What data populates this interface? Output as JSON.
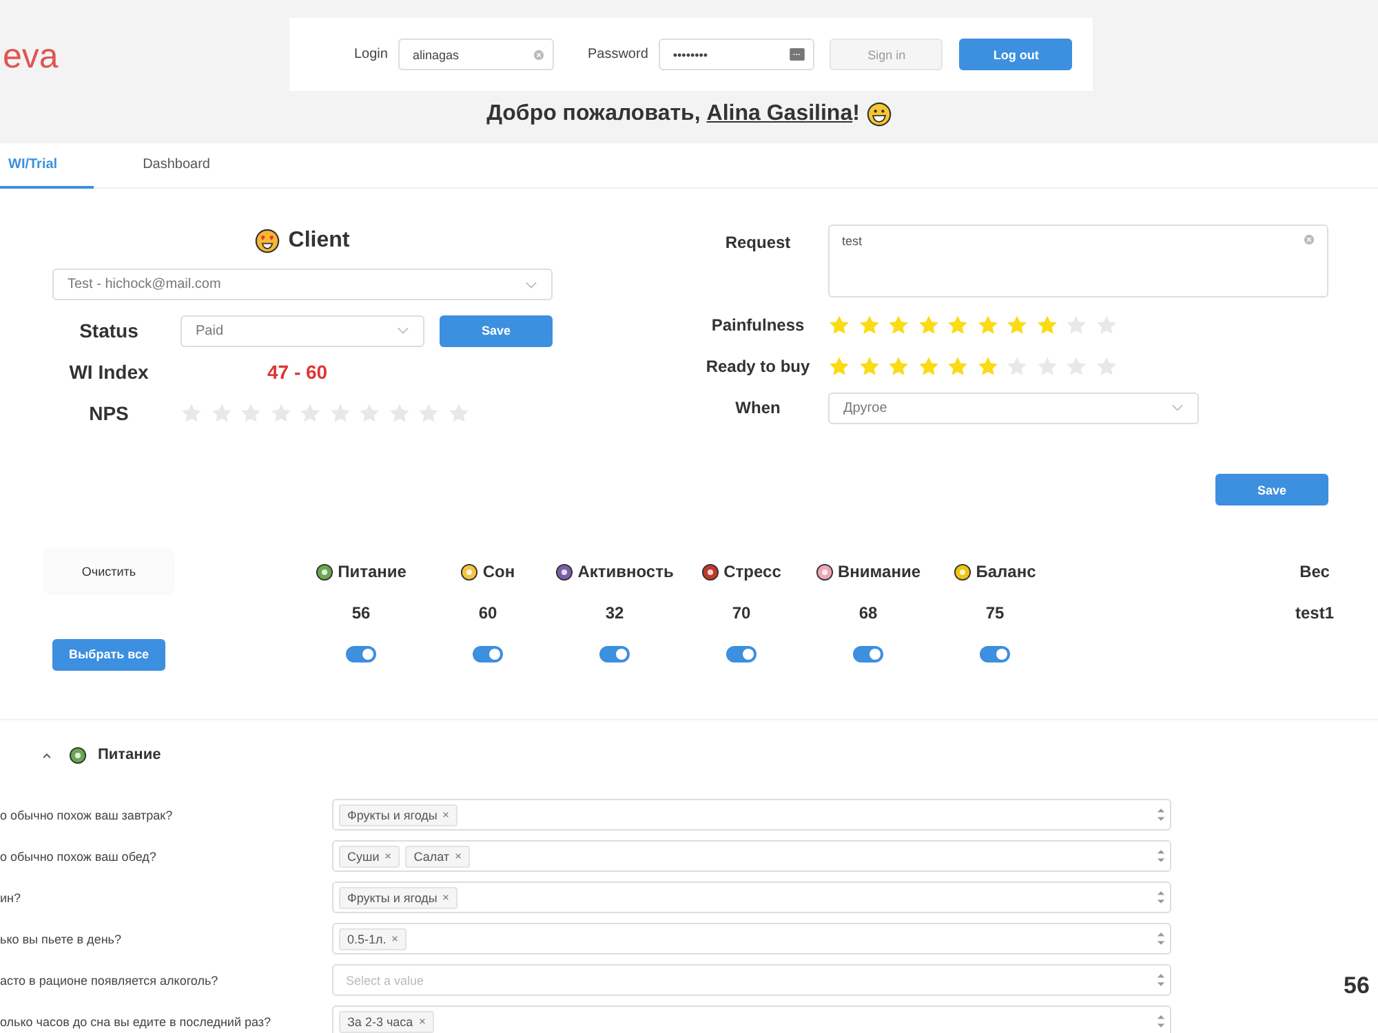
{
  "logo": "eva",
  "login": {
    "label": "Login",
    "value": "alinagas",
    "password_label": "Password",
    "password_value": "••••••••",
    "sign_in": "Sign in",
    "sign_in_disabled": true,
    "log_out": "Log out"
  },
  "welcome": {
    "prefix": "Добро пожаловать, ",
    "name": "Alina Gasilina",
    "suffix": "!"
  },
  "tabs": [
    {
      "label": "WI/Trial",
      "selected": true
    },
    {
      "label": "Dashboard",
      "selected": false
    }
  ],
  "client": {
    "title": "Client",
    "select_value": "Test - hichock@mail.com",
    "status_label": "Status",
    "status_value": "Paid",
    "save": "Save",
    "index_label": "WI Index",
    "index_value": "47 - 60",
    "nps_label": "NPS",
    "nps": {
      "stars": 0
    }
  },
  "request": {
    "label": "Request",
    "value": "test",
    "painfulness_label": "Painfulness",
    "painfulness": {
      "stars": 8
    },
    "ready_label": "Ready to buy",
    "ready": {
      "stars": 6
    },
    "when_label": "When",
    "when_value": "Другое",
    "save": "Save"
  },
  "controls": {
    "clear": "Очистить",
    "select_all": "Выбрать все"
  },
  "categories": [
    {
      "name": "Питание",
      "score": "56",
      "on": true
    },
    {
      "name": "Сон",
      "score": "60",
      "on": true
    },
    {
      "name": "Активность",
      "score": "32",
      "on": true
    },
    {
      "name": "Стресс",
      "score": "70",
      "on": true
    },
    {
      "name": "Внимание",
      "score": "68",
      "on": true
    },
    {
      "name": "Баланс",
      "score": "75",
      "on": true
    }
  ],
  "weight": {
    "label": "Вес",
    "value": "test1"
  },
  "section": {
    "title": "Питание",
    "expanded": true,
    "score": "56"
  },
  "questions": [
    {
      "label": "о обычно похож ваш завтрак?",
      "tags": [
        "Фрукты и ягоды"
      ]
    },
    {
      "label": "о обычно похож ваш обед?",
      "tags": [
        "Суши",
        "Салат"
      ]
    },
    {
      "label": "ин?",
      "tags": [
        "Фрукты и ягоды"
      ]
    },
    {
      "label": "ько вы пьете в день?",
      "tags": [
        "0.5-1л."
      ]
    },
    {
      "label": "асто в рационе появляется алкоголь?",
      "placeholder": "Select a value"
    },
    {
      "label": "олько часов до сна вы едите в последний раз?",
      "tags": [
        "За 2-3 часа"
      ]
    }
  ]
}
